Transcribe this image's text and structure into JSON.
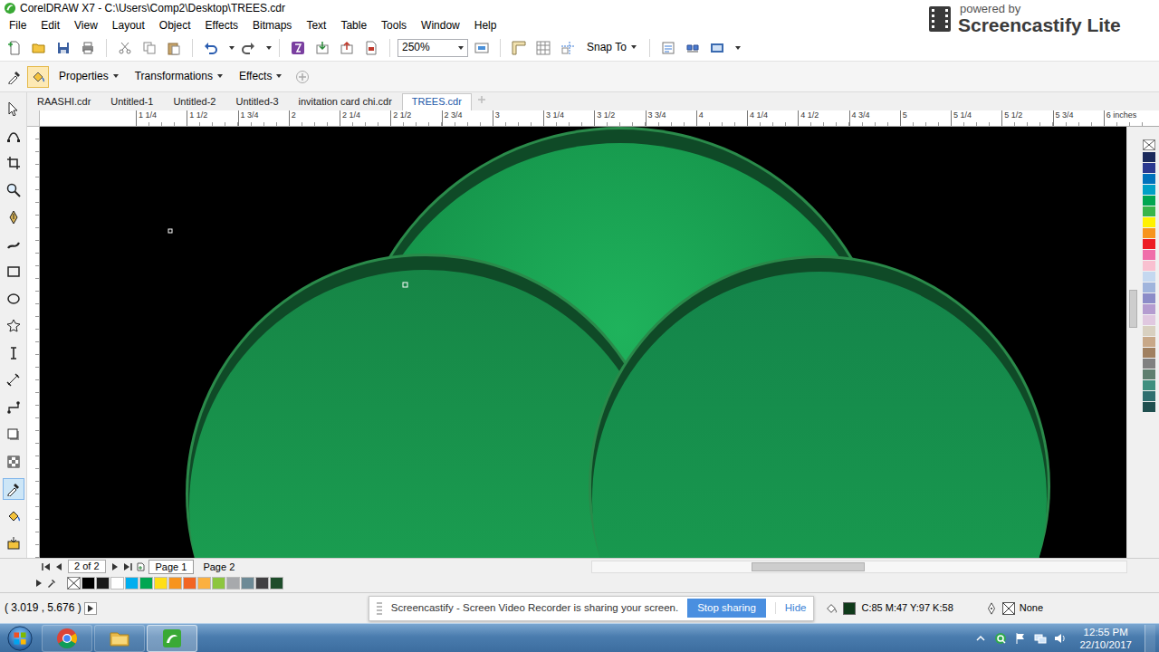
{
  "window": {
    "title": "CorelDRAW X7 - C:\\Users\\Comp2\\Desktop\\TREES.cdr"
  },
  "watermark": {
    "caption": "powered by",
    "brand": "Screencastify Lite"
  },
  "menu": [
    "File",
    "Edit",
    "View",
    "Layout",
    "Object",
    "Effects",
    "Bitmaps",
    "Text",
    "Table",
    "Tools",
    "Window",
    "Help"
  ],
  "toolbar": {
    "zoom": "250%",
    "snap_to": "Snap To"
  },
  "property_bar": [
    "Properties",
    "Transformations",
    "Effects"
  ],
  "toolbox": [
    {
      "selected": false
    },
    {
      "selected": false
    },
    {
      "selected": false
    },
    {
      "selected": false
    },
    {
      "selected": false
    },
    {
      "selected": false
    },
    {
      "selected": false
    },
    {
      "selected": false
    },
    {
      "selected": false
    },
    {
      "selected": false
    },
    {
      "selected": false
    },
    {
      "selected": false
    },
    {
      "selected": false
    },
    {
      "selected": false
    },
    {
      "selected": true
    },
    {
      "selected": false
    },
    {
      "selected": false
    }
  ],
  "document_tabs": [
    {
      "label": "RAASHI.cdr",
      "selected": false
    },
    {
      "label": "Untitled-1",
      "selected": false
    },
    {
      "label": "Untitled-2",
      "selected": false
    },
    {
      "label": "Untitled-3",
      "selected": false
    },
    {
      "label": "invitation card chi.cdr",
      "selected": false
    },
    {
      "label": "TREES.cdr",
      "selected": true
    }
  ],
  "ruler": {
    "labels": [
      "1 1/4",
      "1 1/2",
      "1 3/4",
      "2",
      "2 1/4",
      "2 1/2",
      "2 3/4",
      "3",
      "3 1/4",
      "3 1/2",
      "3 3/4",
      "4",
      "4 1/4",
      "4 1/2",
      "4 3/4",
      "5",
      "5 1/4",
      "5 1/2",
      "5 3/4",
      "6 inches"
    ]
  },
  "page_nav": {
    "counter": "2 of 2",
    "pages": [
      {
        "label": "Page 1",
        "selected": true
      },
      {
        "label": "Page 2",
        "selected": false
      }
    ]
  },
  "side_palette": [
    {
      "color": "#1b2a5c"
    },
    {
      "color": "#2b3990"
    },
    {
      "color": "#0072bc"
    },
    {
      "color": "#00a0c6"
    },
    {
      "color": "#00a651"
    },
    {
      "color": "#39b54a"
    },
    {
      "color": "#fff200"
    },
    {
      "color": "#f7941d"
    },
    {
      "color": "#ed1c24"
    },
    {
      "color": "#f06eaa"
    },
    {
      "color": "#f9c0d0"
    },
    {
      "color": "#c4d8f0"
    },
    {
      "color": "#a0b4dc"
    },
    {
      "color": "#8c8cc8"
    },
    {
      "color": "#b49cd0"
    },
    {
      "color": "#e0c8e0"
    },
    {
      "color": "#d8d0c0"
    },
    {
      "color": "#c8a888"
    },
    {
      "color": "#a08060"
    },
    {
      "color": "#808080"
    },
    {
      "color": "#5f7f6f"
    },
    {
      "color": "#3f8f7f"
    },
    {
      "color": "#2f6f6f"
    },
    {
      "color": "#1f4f4f"
    }
  ],
  "bottom_palette": [
    {
      "color": "#000000"
    },
    {
      "color": "#1a1a1a"
    },
    {
      "color": "#ffffff"
    },
    {
      "color": "#00aeef"
    },
    {
      "color": "#00a651"
    },
    {
      "color": "#ffde17"
    },
    {
      "color": "#f7941d"
    },
    {
      "color": "#f26522"
    },
    {
      "color": "#fbb040"
    },
    {
      "color": "#8dc63f"
    },
    {
      "color": "#a7a9ac"
    },
    {
      "color": "#6d8a96"
    },
    {
      "color": "#414042"
    },
    {
      "color": "#1e4d2b"
    }
  ],
  "status_bar": {
    "coordinates": "( 3.019 , 5.676 )",
    "fill": {
      "text": "C:85 M:47 Y:97 K:58",
      "color": "#0f3a1a"
    },
    "outline": "None"
  },
  "notification": {
    "text": "Screencastify - Screen Video Recorder is sharing your screen.",
    "button": "Stop sharing",
    "link": "Hide"
  },
  "taskbar": {
    "time": "12:55 PM",
    "date": "22/10/2017"
  }
}
